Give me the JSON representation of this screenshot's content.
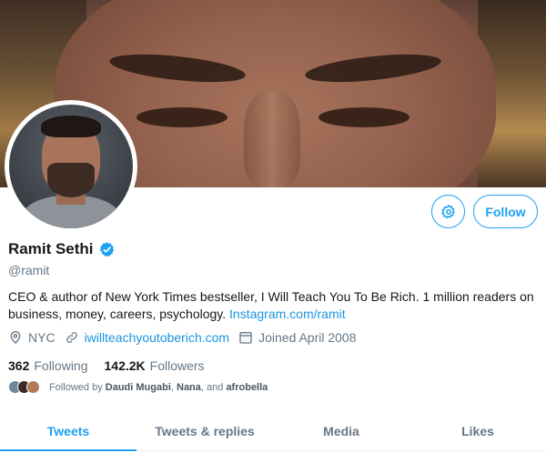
{
  "profile": {
    "name": "Ramit Sethi",
    "handle": "@ramit",
    "bio_text": "CEO & author of New York Times bestseller, I Will Teach You To Be Rich. 1 million readers on business, money, careers, psychology.",
    "bio_link": "Instagram.com/ramit",
    "location": "NYC",
    "website": "iwillteachyoutoberich.com",
    "joined": "Joined April 2008"
  },
  "actions": {
    "follow_label": "Follow",
    "settings_icon": "gear-icon"
  },
  "stats": {
    "following_count": "362",
    "following_label": "Following",
    "followers_count": "142.2K",
    "followers_label": "Followers"
  },
  "followed_by": {
    "prefix": "Followed by",
    "name1": "Daudi Mugabi",
    "sep1": ", ",
    "name2": "Nana",
    "sep2": ", and ",
    "name3": "afrobella"
  },
  "tabs": [
    {
      "label": "Tweets",
      "active": true
    },
    {
      "label": "Tweets & replies",
      "active": false
    },
    {
      "label": "Media",
      "active": false
    },
    {
      "label": "Likes",
      "active": false
    }
  ],
  "colors": {
    "accent": "#1da1f2",
    "link": "#1b95e0",
    "secondary_text": "#657786"
  }
}
